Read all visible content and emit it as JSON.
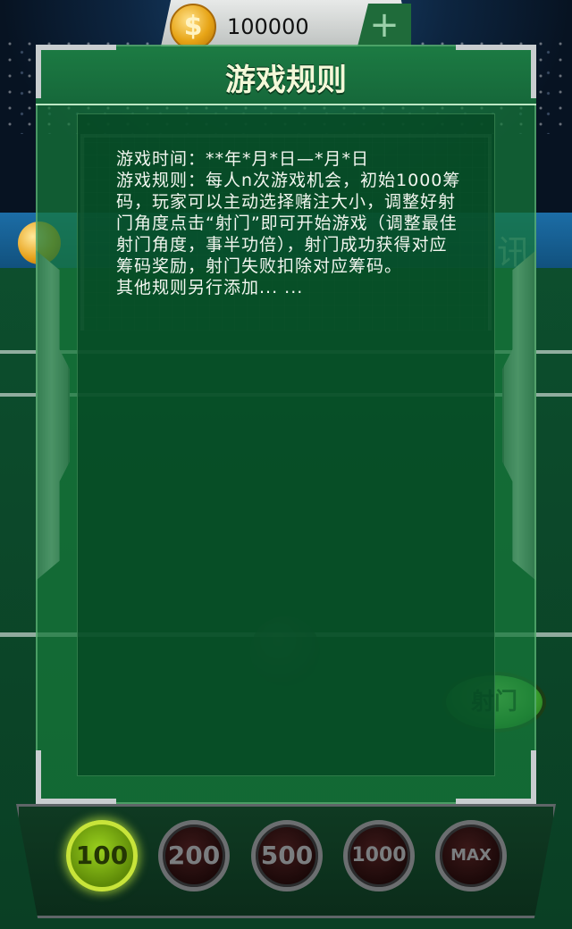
{
  "currency": {
    "icon": "dollar-coin-icon",
    "symbol": "$",
    "amount": "100000",
    "add_icon": "plus-icon",
    "add_label": "+"
  },
  "background": {
    "ad_text": "讯"
  },
  "dialog": {
    "title": "游戏规则",
    "rules_text": "游戏时间：**年*月*日—*月*日\n游戏规则：每人n次游戏机会，初始1000筹码，玩家可以主动选择赌注大小，调整好射门角度点击“射门”即可开始游戏（调整最佳射门角度，事半功倍），射门成功获得对应筹码奖励，射门失败扣除对应筹码。\n其他规则另行添加... ..."
  },
  "shoot_button": {
    "label": "射门"
  },
  "bet_chips": [
    {
      "label": "100",
      "selected": true
    },
    {
      "label": "200",
      "selected": false
    },
    {
      "label": "500",
      "selected": false
    },
    {
      "label": "1000",
      "selected": false
    },
    {
      "label": "MAX",
      "selected": false
    }
  ],
  "colors": {
    "dialog_green": "#16783a",
    "selected_chip": "#9bd21e",
    "gold": "#e7a416"
  }
}
